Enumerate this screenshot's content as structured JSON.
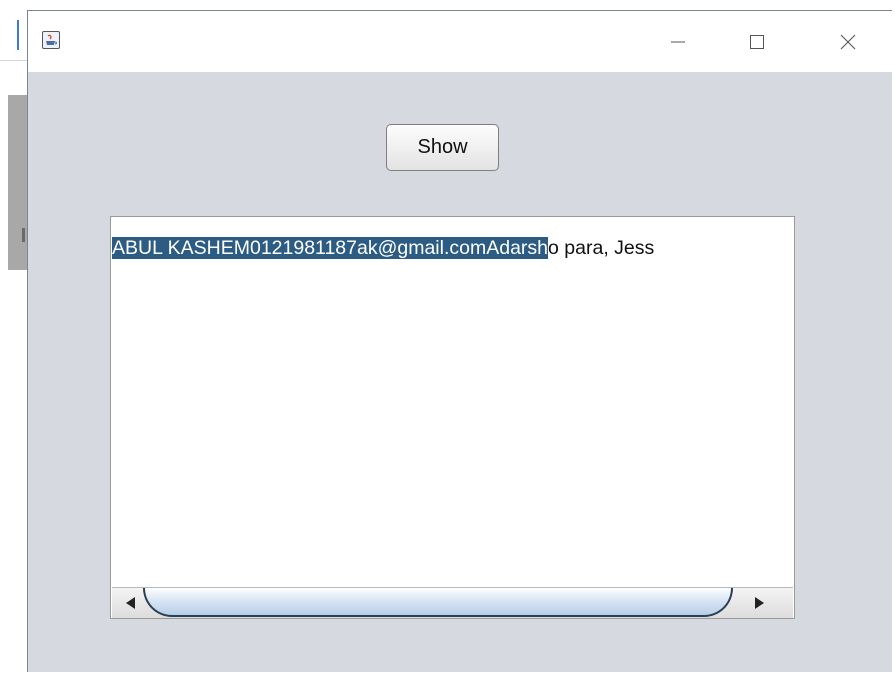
{
  "window": {
    "title": "",
    "minimize_glyph": "—",
    "maximize_glyph": "☐",
    "close_glyph": "✕",
    "icon": "java-cup-icon"
  },
  "main": {
    "show_button_label": "Show",
    "text_selected": "ABUL KASHEM0121981187ak@gmail.comAdarsh",
    "text_unselected": "o para, Jess"
  },
  "colors": {
    "selection_bg": "#2c5b84",
    "window_bg": "#d6d9df"
  }
}
